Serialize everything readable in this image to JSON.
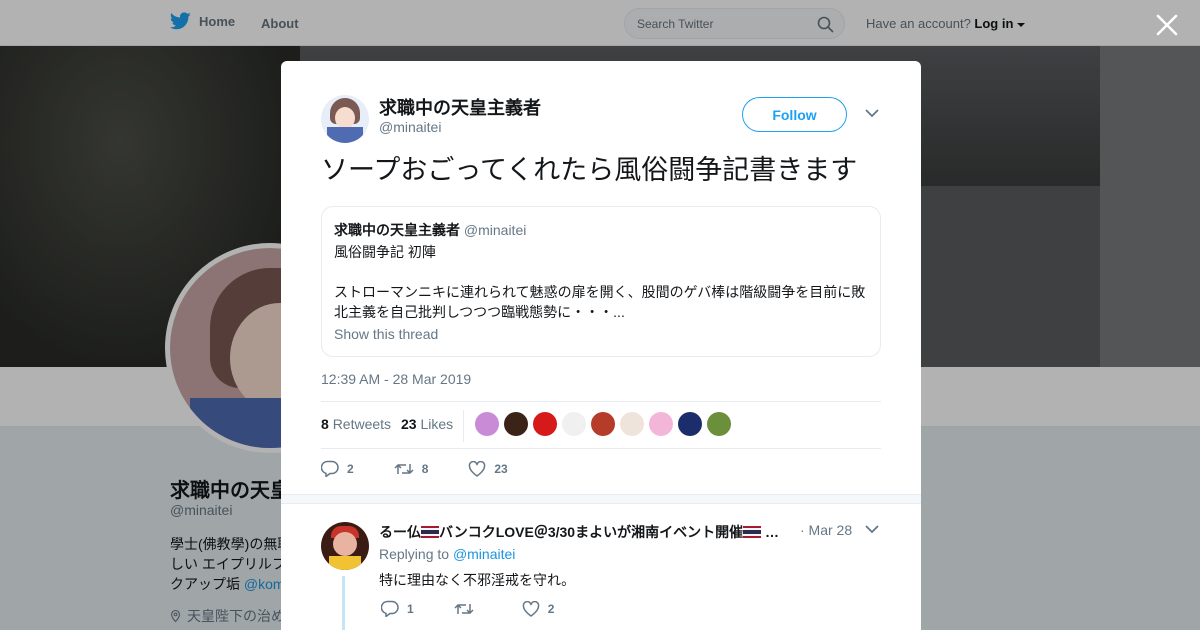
{
  "nav": {
    "home_label": "Home",
    "about_label": "About",
    "search_placeholder": "Search Twitter",
    "account_prompt": "Have an account?",
    "login_label": "Log in"
  },
  "profile_bg": {
    "name": "求職中の天皇",
    "handle": "@minaitei",
    "bio_line1": "學士(佛教學)の無職",
    "bio_line2": "しい エイプリルフ",
    "bio_line3_prefix": "クアップ垢 ",
    "bio_line3_link": "@kom",
    "location": "天皇陛下の治め"
  },
  "tweet": {
    "author_name": "求職中の天皇主義者",
    "author_handle": "@minaitei",
    "follow_label": "Follow",
    "text": "ソープおごってくれたら風俗闘争記書きます",
    "quote": {
      "author_name": "求職中の天皇主義者",
      "author_handle": "@minaitei",
      "text": "風俗闘争記 初陣\n\nストローマンニキに連れられて魅惑の扉を開く、股間のゲバ棒は階級闘争を目前に敗北主義を自己批判しつつつ臨戦態勢に・・・...",
      "show_thread": "Show this thread"
    },
    "timestamp": "12:39 AM - 28 Mar 2019",
    "retweets_count": "8",
    "retweets_label": "Retweets",
    "likes_count": "23",
    "likes_label": "Likes",
    "reply_count": "2",
    "retweet_count": "8",
    "like_count": "23"
  },
  "likers": [
    "#c98ad6",
    "#3b2417",
    "#d61a1a",
    "#f0f0f0",
    "#b63c2a",
    "#efe4dc",
    "#f4b6d8",
    "#1b2d6b",
    "#6b8f3a"
  ],
  "reply": {
    "author_prefix": "るー仏",
    "author_middle": "バンコクLOVE＠3/30まよいが湘南イベント開催",
    "author_suffix": " …",
    "date": "· Mar 28",
    "replying_to_label": "Replying to",
    "replying_to_handle": "@minaitei",
    "text": "特に理由なく不邪淫戒を守れ。",
    "reply_count": "1",
    "retweet_count": "",
    "like_count": "2"
  },
  "colors": {
    "twitter_blue": "#1da1f2",
    "text_primary": "#14171a",
    "text_secondary": "#657786"
  }
}
